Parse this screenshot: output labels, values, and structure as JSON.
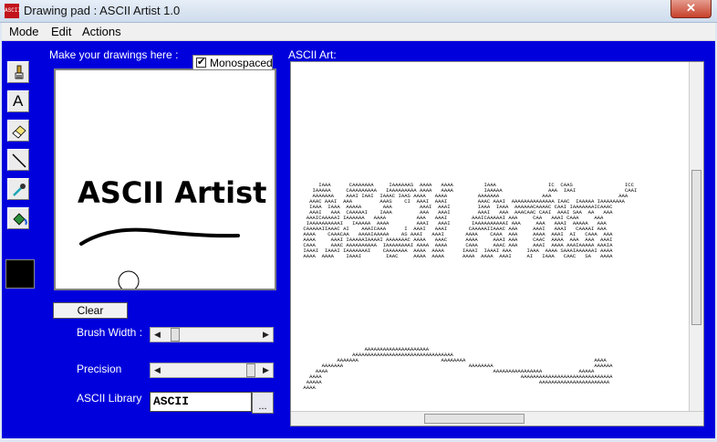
{
  "window": {
    "title": "Drawing pad : ASCII Artist 1.0",
    "icon_text": "ASCII",
    "close_glyph": "✕"
  },
  "menu": [
    {
      "label": "Mode"
    },
    {
      "label": "Edit"
    },
    {
      "label": "Actions"
    }
  ],
  "tools": [
    {
      "icon": "brush-icon"
    },
    {
      "icon": "text-icon",
      "glyph": "A"
    },
    {
      "icon": "eraser-icon"
    },
    {
      "icon": "line-icon"
    },
    {
      "icon": "eyedropper-icon"
    },
    {
      "icon": "paint-bucket-icon"
    }
  ],
  "color": {
    "current": "#000000",
    "panel_bg": "#0000dc"
  },
  "drawing": {
    "label": "Make your drawings here :",
    "text": "ASCII Artist",
    "monospaced_label": "Monospaced",
    "monospaced_checked": true,
    "check_glyph": "✔"
  },
  "controls": {
    "clear_label": "Clear",
    "brush_width_label": "Brush Width :",
    "precision_label": "Precision",
    "library_label": "ASCII Library",
    "library_value": "ASCII",
    "library_button": "...",
    "brush_width_level": 0.15,
    "precision_level": 0.95,
    "left_arrow": "◀",
    "right_arrow": "▶"
  },
  "ascii": {
    "label": "ASCII Art:",
    "art": "\n\n\n\n\n\n\n\n\n\n\n\n\n\n\n\n\n\n\n\n\n\n         IAAA      CAAAAAAA     IAAAAAAS  AAAA   AAAA          IAAA                 IC  CAAS                 ICC\n       IAAAAA     CAAAAAAAAA   IAAAAAAAAA AAAA   AAAA          IAAAAA               AAA  IAAI                CAAI\n       AAAAAAA    AAAI IAAI  IAAAC IAAS AAAA   AAAA          AAAAAAA              AAA                      AAA\n      AAAC AAAI  AAA         AAAS    CI  AAAI  AAAI          AAAC AAAI  AAAAAAAAAAAAAA IAAC  IAAAAA IAAAAAAAA\n      IAAA  IAAA  AAAAA       AAA         AAAI  AAAI         IAAA  IAAA  AAAAAACAAAAC CAAI IAAAAAAAICAAAC\n      AAAI   AAA  CAAAAAI    IAAA         AAA   AAAI         AAAI   AAA  AAACAAC CAAI  AAAI SAA  AA   AAA\n     AAAICAAAAAI IAAAAAA   AAAA          AAA   AAAI        AAAICAAAAAI AAA     CAA   AAAI CAAA     AAA\n     IAAAAAAAAAAI   IAAAAA  AAAA         AAAI   AAAI       IAAAAAAAAAAI AAA     AAA   AAAI  AAAAA   AAA\n    CAAAAAIIAAAC AI    AAAICAAA      I  AAAI   AAAI       CAAAAAIIAAAC AAA     AAAI   AAAI   CAAAAI AAA\n    AAAA    CAAACAA   AAAAIAAAAA    AS AAAI   AAAI       AAAA    CAAA  AAA     AAAA  AAAI  AI   CAAA  AAA\n    AAAA     AAAI IAAAAAIAAAAI AAAAAAAC AAAA   AAAC      AAAA     AAAI AAA     CAAC  AAAA  AAA  AAA  AAAI\n    CAAA     AAAC AAAAAAAAAA  IAAAAAAAAI AAAA  AAAA      CAAA     AAAC AAA     AAAI  AAAA AAAIAAAAA AAAIA\n    IAAAI  IAAAI IAAAAAAAI    CAAAAAAA  AAAA  AAAA      IAAAI  IAAAI AAA     IAAA  AAAA SAAAIAAAAAAI AAAA\n    AAAA  AAAA    IAAAI        IAAC     AAAA  AAAA      AAAA  AAAA  AAAI     AI   IAAA   CAAC   SA   AAAA\n\n\n\n\n\n\n\n\n\n\n\n\n\n\n\n\n                        AAAAAAAAAAAAAAAAAAAAA\n                    AAAAAAAAAAAAAAAAAAAAAAAAAAAAAAAAA\n               AAAAAAA                           AAAAAAAA                                          AAAA\n          AAAAAAA                                         AAAAAAAA                                 AAAAAA\n        AAAA                                                      AAAAAAAAAAAAAAAA            AAAAA\n      AAAA                                                                 AAAAAAAAAAAAAAAAAAAAAAAAAAAAAA\n     AAAAA                                                                       AAAAAAAAAAAAAAAAAAAAAAA\n    AAAA"
  }
}
